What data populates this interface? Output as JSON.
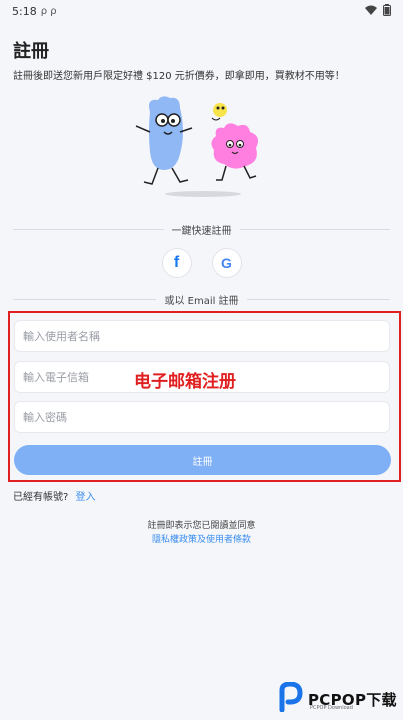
{
  "status_bar": {
    "time": "5:18",
    "notifications": "ρ ρ"
  },
  "page": {
    "title": "註冊",
    "promo": "註冊後即送您新用戶限定好禮 $120 元折價券，即拿即用，買教材不用等！"
  },
  "social": {
    "divider_label": "一鍵快速註冊",
    "icons": [
      "facebook-icon",
      "google-icon"
    ],
    "facebook_glyph": "f",
    "google_glyph": "G"
  },
  "email_section": {
    "divider_label": "或以 Email 註冊",
    "username_placeholder": "輸入使用者名稱",
    "email_placeholder": "輸入電子信箱",
    "password_placeholder": "輸入密碼",
    "submit_label": "註冊",
    "overlay_label": "电子邮箱注册"
  },
  "login": {
    "prompt": "已經有帳號?",
    "link": "登入"
  },
  "terms": {
    "text": "註冊即表示您已閱讀並同意",
    "link": "隱私權政策及使用者條款"
  },
  "brand": {
    "name": "PCPOP下载",
    "sub": "PCPOP Download"
  },
  "colors": {
    "accent": "#3a8ef0",
    "button": "#7fb0f6",
    "highlight": "#e02020",
    "background": "#f5f6fa"
  }
}
